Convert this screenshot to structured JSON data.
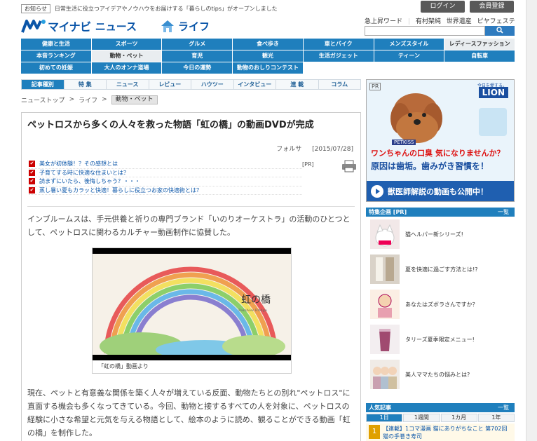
{
  "notice": {
    "badge": "お知らせ",
    "text": "日常生活に役立つアイデアやノウハウをお届けする「暮らしのtips」がオープンしました"
  },
  "top_buttons": [
    "ログイン",
    "会員登録"
  ],
  "logo": {
    "brand": "マイナビ",
    "news": "ニュース",
    "section": "ライフ"
  },
  "trend": {
    "label": "急上昇ワード",
    "words": [
      "有村架純",
      "世界遺産",
      "ピヤフェステ"
    ]
  },
  "search": {
    "placeholder": "",
    "button": ""
  },
  "gnav": [
    "健康と生活",
    "スポーツ",
    "グルメ",
    "食べ歩き",
    "車とバイク",
    "メンズスタイル",
    "レディースファッション",
    "本音ランキング",
    "動物・ペット",
    "育児",
    "観光",
    "生活ガジェット",
    "ティーン",
    "自転車",
    "初めての妊娠",
    "大人のオンナ道場",
    "今日の運勢",
    "動物のおしりコンテスト"
  ],
  "gnav_active": "動物・ペット",
  "subnav": [
    "記事種別",
    "特 集",
    "ニュース",
    "レビュー",
    "ハウツー",
    "インタビュー",
    "連 載",
    "コラム"
  ],
  "breadcrumb": {
    "items": [
      "ニューストップ",
      "ライフ"
    ],
    "current": "動物・ペット"
  },
  "article": {
    "title": "ペットロスから多くの人々を救った物語「虹の橋」の動画DVDが完成",
    "author": "フォルサ",
    "date": "[2015/07/28]",
    "pr_tag": "[PR]",
    "pr_links": [
      "美女が初体験！？その感想とは",
      "子育てする時に快適な住まいとは？",
      "読まずにいたら、後悔しちゃう？・・・",
      "蒸し暑い夏もカラッと快適！暮らしに役立つお家の快適術とは？"
    ],
    "para1": "インブルームスは、手元供養と祈りの専門ブランド「いのりオーケストラ」の活動のひとつとして、ペットロスに関わるカルチャー動画制作に協賛した。",
    "video_title": "虹の橋",
    "video_sub": "Rainbow Bridge",
    "caption": "「虹の橋」動画より",
    "para2": "現在、ペットと有意義な関係を築く人々が増えている反面、動物たちとの別れ\"ペットロス\"に直面する機会も多くなってきている。今回、動物と接するすべての人を対象に、ペットロスの経験に小さな希望と元気を与える物語として、絵本のように読め、観ることができる動画「虹の橋」を制作した。"
  },
  "ad": {
    "pr": "PR",
    "brand_sub": "今日を愛する。",
    "brand": "LION",
    "product": "PETKISS",
    "line1": "ワンちゃんの口臭 気になりませんか？",
    "line2": "原因は歯垢。歯みがき習慣を！",
    "cta": "獣医師解説の動画も公開中！"
  },
  "special": {
    "heading": "特集企画 [PR]",
    "more": "一覧",
    "items": [
      "猫ヘルパー新シリーズ!",
      "夏を快適に過ごす方法とは!?",
      "あなたはズボラさんですか？",
      "タリーズ夏季限定メニュー!",
      "美人ママたちの悩みとは?"
    ]
  },
  "ranking": {
    "heading": "人気記事",
    "more": "一覧",
    "tabs": [
      "1日",
      "1週間",
      "1カ月",
      "1年"
    ],
    "first": {
      "num": "1",
      "text": "【連載】1コマ漫画 猫にありがちなこと 第702回 猫の手巻き寿司"
    }
  },
  "colors": {
    "nav_blue": "#1f7fbd",
    "brand_blue": "#0a55a8",
    "ad_red": "#dd1111"
  }
}
